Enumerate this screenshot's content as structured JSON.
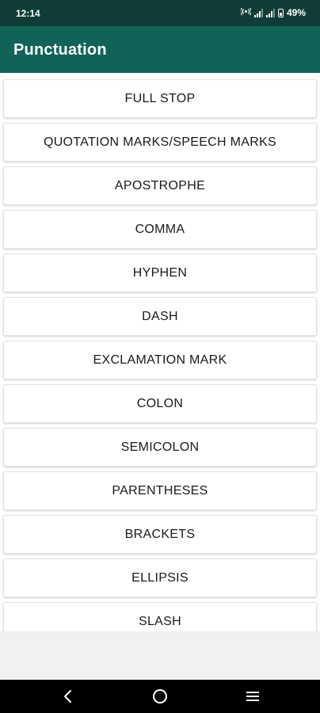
{
  "status_bar": {
    "time": "12:14",
    "battery_percent": "49%",
    "icons": [
      "hotspot-icon",
      "signal-icon",
      "signal-icon",
      "battery-icon"
    ]
  },
  "app_bar": {
    "title": "Punctuation",
    "background": "#116358"
  },
  "list": {
    "items": [
      "FULL STOP",
      "QUOTATION MARKS/SPEECH MARKS",
      "APOSTROPHE",
      "COMMA",
      "HYPHEN",
      "DASH",
      "EXCLAMATION MARK",
      "COLON",
      "SEMICOLON",
      "PARENTHESES",
      "BRACKETS",
      "ELLIPSIS",
      "SLASH"
    ]
  },
  "nav_bar": {
    "buttons": [
      "back-icon",
      "home-icon",
      "recents-icon"
    ]
  }
}
